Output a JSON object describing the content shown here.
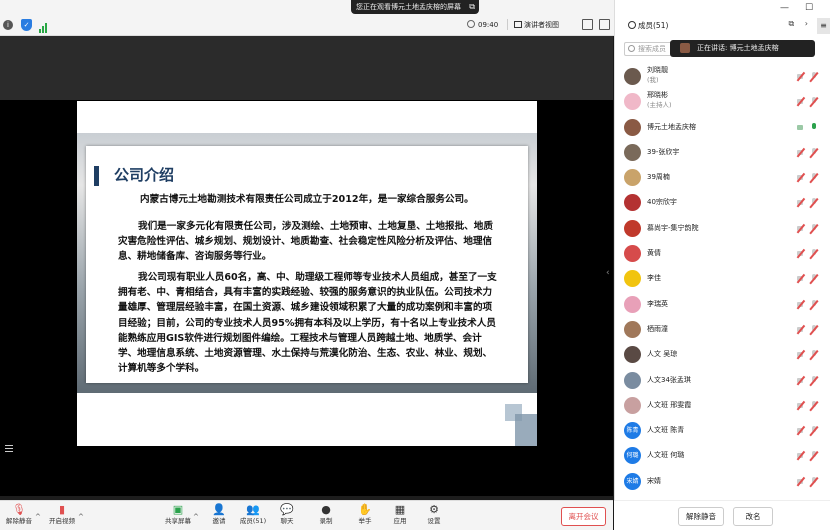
{
  "share_banner": {
    "text": "您正在观看博元土地孟庆榕的屏幕",
    "icon": "stop-share-icon"
  },
  "topbar": {
    "time": "09:40",
    "view_label": "演讲者视图",
    "icons": [
      "info-icon",
      "shield-icon",
      "signal-icon",
      "fullscreen-icon",
      "exit-fullscreen-icon",
      "layout-icon"
    ]
  },
  "slide": {
    "title": "公司介绍",
    "paragraphs": [
      "内蒙古博元土地勘测技术有限责任公司成立于2012年，是一家综合服务公司。",
      "我们是一家多元化有限责任公司，涉及测绘、土地预审、土地复垦、土地报批、地质灾害危险性评估、城乡规划、规划设计、地质勘查、社会稳定性风险分析及评估、地理信息、耕地储备库、咨询服务等行业。",
      "我公司现有职业人员60名，高、中、助理级工程师等专业技术人员组成，甚至了一支拥有老、中、青相结合，具有丰富的实践经验、较强的服务意识的执业队伍。公司技术力量雄厚、管理层经验丰富，在国土资源、城乡建设领域积累了大量的成功案例和丰富的项目经验；目前，公司的专业技术人员95%拥有本科及以上学历，有十名以上专业技术人员能熟练应用GIS软件进行规划图件编绘。工程技术与管理人员跨越土地、地质学、会计学、地理信息系统、土地资源管理、水土保持与荒漠化防治、生态、农业、林业、规划、计算机等多个学科。"
    ]
  },
  "toolbar": {
    "items": [
      {
        "label": "解除静音",
        "icon": "microphone-muted-icon"
      },
      {
        "label": "开启视频",
        "icon": "video-camera-off-icon"
      },
      {
        "label": "共享屏幕",
        "icon": "share-screen-icon"
      },
      {
        "label": "邀请",
        "icon": "invite-icon"
      },
      {
        "label": "成员(51)",
        "icon": "members-icon"
      },
      {
        "label": "聊天",
        "icon": "chat-icon"
      },
      {
        "label": "录制",
        "icon": "record-icon"
      },
      {
        "label": "举手",
        "icon": "raise-hand-icon"
      },
      {
        "label": "应用",
        "icon": "apps-icon"
      },
      {
        "label": "设置",
        "icon": "settings-icon"
      }
    ],
    "leave": "离开会议"
  },
  "panel": {
    "title": "成员(51)",
    "search_placeholder": "搜索成员",
    "speaking": "正在讲话: 博元土地孟庆榕",
    "members": [
      {
        "name": "刘晓靓",
        "role": "(我)",
        "av": "#6b5a4e",
        "txt": ""
      },
      {
        "name": "邢晓彬",
        "role": "(主持人)",
        "av": "#f0b8c8",
        "txt": ""
      },
      {
        "name": "博元土地孟庆榕",
        "role": "",
        "av": "#8a5a44",
        "txt": "",
        "speaking": true
      },
      {
        "name": "39-张欣宇",
        "role": "",
        "av": "#7a6a5a",
        "txt": ""
      },
      {
        "name": "39周楠",
        "role": "",
        "av": "#c9a36a",
        "txt": ""
      },
      {
        "name": "40宗欣宇",
        "role": "",
        "av": "#b43232",
        "txt": ""
      },
      {
        "name": "慕尚宇-集宁韵院",
        "role": "",
        "av": "#c0392b",
        "txt": ""
      },
      {
        "name": "黄倩",
        "role": "",
        "av": "#d64b4b",
        "txt": ""
      },
      {
        "name": "李佳",
        "role": "",
        "av": "#f1c40f",
        "txt": ""
      },
      {
        "name": "李瑞英",
        "role": "",
        "av": "#e8a0b8",
        "txt": ""
      },
      {
        "name": "栖雨潼",
        "role": "",
        "av": "#a0785a",
        "txt": ""
      },
      {
        "name": "人文   吴琼",
        "role": "",
        "av": "#5a4a44",
        "txt": ""
      },
      {
        "name": "人文34张孟琪",
        "role": "",
        "av": "#7a8ca0",
        "txt": ""
      },
      {
        "name": "人文班 邢雯霞",
        "role": "",
        "av": "#c8a0a0",
        "txt": ""
      },
      {
        "name": "人文班 陈青",
        "role": "",
        "av": "#1e7be6",
        "txt": "陈青"
      },
      {
        "name": "人文班 何璐",
        "role": "",
        "av": "#1e7be6",
        "txt": "何璐"
      },
      {
        "name": "宋婧",
        "role": "",
        "av": "#1e7be6",
        "txt": "宋婧"
      }
    ],
    "footer": {
      "unmute_all": "解除静音",
      "rename": "改名"
    }
  }
}
